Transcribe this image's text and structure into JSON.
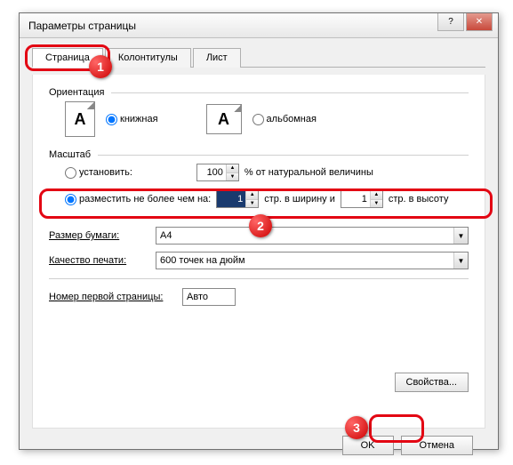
{
  "window": {
    "title": "Параметры страницы"
  },
  "tabs": {
    "page": "Страница",
    "headers": "Колонтитулы",
    "sheet": "Лист"
  },
  "orientation": {
    "group": "Ориентация",
    "portrait": "книжная",
    "landscape": "альбомная"
  },
  "scale": {
    "group": "Масштаб",
    "adjust_label": "установить:",
    "adjust_value": "100",
    "adjust_suffix": "% от натуральной величины",
    "fit_label": "разместить не более чем на:",
    "fit_w": "1",
    "fit_mid": "стр. в ширину и",
    "fit_h": "1",
    "fit_suffix": "стр. в высоту"
  },
  "paper": {
    "size_label": "Размер бумаги:",
    "size_value": "A4",
    "quality_label": "Качество печати:",
    "quality_value": "600 точек на дюйм",
    "first_page_label": "Номер первой страницы:",
    "first_page_value": "Авто"
  },
  "buttons": {
    "properties": "Свойства...",
    "ok": "OK",
    "cancel": "Отмена"
  },
  "badges": {
    "b1": "1",
    "b2": "2",
    "b3": "3"
  }
}
